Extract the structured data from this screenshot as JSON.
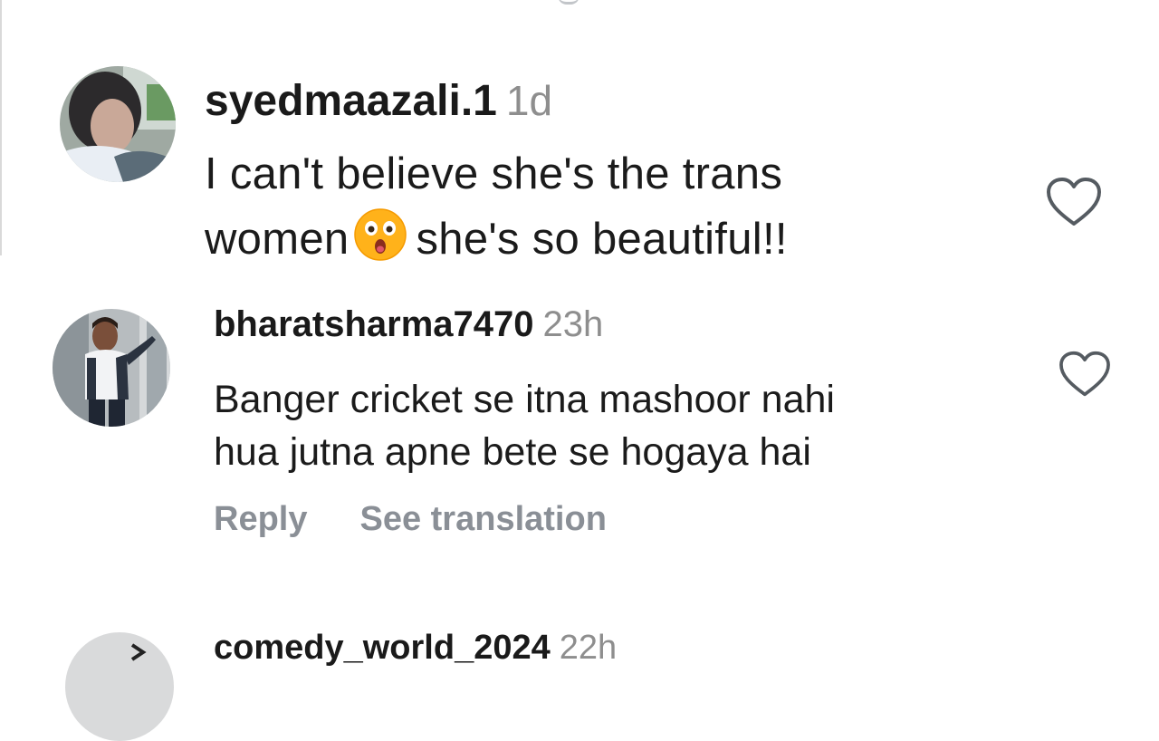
{
  "comments": [
    {
      "username": "syedmaazali.1",
      "time": "1d",
      "lines": [
        "I can't believe she's the trans",
        "women",
        "she's so beautiful!!"
      ],
      "emoji": "astonished-face",
      "liked": false
    },
    {
      "username": "bharatsharma7470",
      "time": "23h",
      "lines": [
        "Banger cricket se itna mashoor nahi",
        "hua jutna apne bete se hogaya hai"
      ],
      "actions": {
        "reply": "Reply",
        "translate": "See translation"
      },
      "liked": false
    },
    {
      "username": "comedy_world_2024",
      "time": "22h"
    }
  ],
  "colors": {
    "text": "#161616",
    "muted": "#8e8e8e",
    "action": "#8a8f96"
  }
}
